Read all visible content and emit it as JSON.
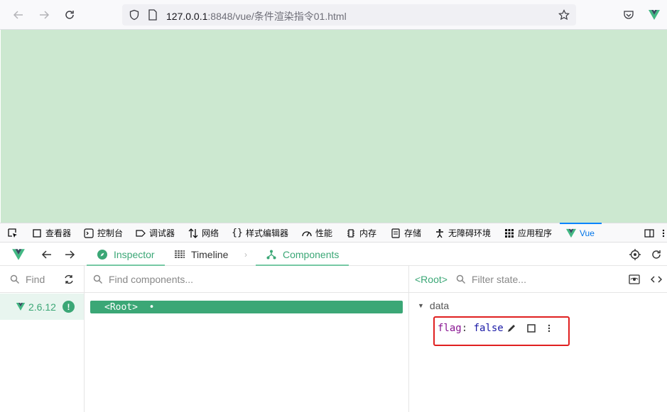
{
  "browser": {
    "url_host": "127.0.0.1",
    "url_rest": ":8848/vue/条件渲染指令01.html"
  },
  "devtools_tabs": [
    {
      "label": "查看器",
      "icon": "inspector-icon"
    },
    {
      "label": "控制台",
      "icon": "console-icon"
    },
    {
      "label": "调试器",
      "icon": "debugger-icon"
    },
    {
      "label": "网络",
      "icon": "network-icon"
    },
    {
      "label": "样式编辑器",
      "icon": "style-editor-icon"
    },
    {
      "label": "性能",
      "icon": "performance-icon"
    },
    {
      "label": "内存",
      "icon": "memory-icon"
    },
    {
      "label": "存储",
      "icon": "storage-icon"
    },
    {
      "label": "无障碍环境",
      "icon": "accessibility-icon"
    },
    {
      "label": "应用程序",
      "icon": "application-icon"
    },
    {
      "label": "Vue",
      "icon": "vue-logo-icon"
    }
  ],
  "vue": {
    "tabs": {
      "inspector": "Inspector",
      "timeline": "Timeline",
      "components": "Components"
    },
    "find_placeholder": "Find",
    "version": "2.6.12",
    "find_components_placeholder": "Find components...",
    "root_component": "<Root>",
    "selected_component": "<Root>",
    "filter_state_placeholder": "Filter state...",
    "state_section": "data",
    "state": [
      {
        "key": "flag",
        "value": "false"
      }
    ]
  },
  "colors": {
    "page_background": "#cce8d0",
    "vue_accent": "#42b883",
    "highlight": "#e02020"
  }
}
